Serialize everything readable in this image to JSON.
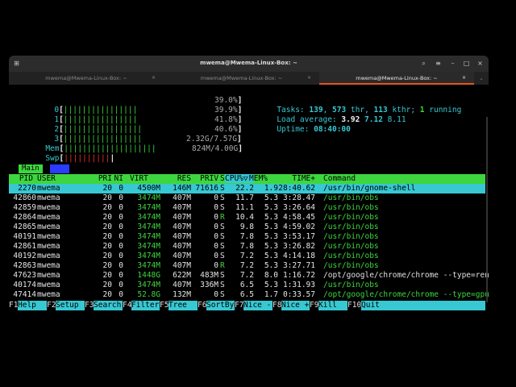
{
  "window": {
    "title": "mwema@Mwema-Linux-Box: ~",
    "tabs": [
      {
        "label": "mwema@Mwema-Linux-Box: ~",
        "active": false
      },
      {
        "label": "mwema@Mwema-Linux-Box: ~",
        "active": false
      },
      {
        "label": "mwema@Mwema-Linux-Box: ~",
        "active": true
      }
    ],
    "tab_close": "×"
  },
  "meters": {
    "cpus": [
      {
        "num": "0",
        "bar": "||||||||||||||||",
        "pct": "39.0%"
      },
      {
        "num": "1",
        "bar": "||||||||||||||||",
        "pct": "39.9%"
      },
      {
        "num": "2",
        "bar": "|||||||||||||||||",
        "pct": "41.8%"
      },
      {
        "num": "3",
        "bar": "|||||||||||||||||",
        "pct": "40.6%"
      }
    ],
    "mem": {
      "label": "Mem",
      "bar": "||||||||||||||||||||",
      "value": "2.32G/7.57G"
    },
    "swp": {
      "label": "Swp",
      "bar": "||||||||||",
      "value": "824M/4.00G"
    }
  },
  "summary": {
    "tasks_label": "Tasks:",
    "tasks": "139",
    "thr": "573",
    "thr_label": "thr,",
    "kthr": "113",
    "kthr_label": "kthr;",
    "running": "1",
    "running_label": "running",
    "load_label": "Load average:",
    "load1": "3.92",
    "load5": "7.12",
    "load15": "8.11",
    "uptime_label": "Uptime:",
    "uptime": "08:40:00"
  },
  "screen_tabs": [
    "Main",
    "I/O"
  ],
  "columns": [
    "PID",
    "USER",
    "PRI",
    "NI",
    "VIRT",
    "RES",
    "PRIV",
    "S",
    "CPU%▽",
    "MEM%",
    "TIME+",
    "Command"
  ],
  "processes": [
    {
      "pid": "2270",
      "user": "mwema",
      "pri": "20",
      "ni": "0",
      "virt": "4500M",
      "res": "146M",
      "priv": "71616",
      "s": "S",
      "cpu": "22.2",
      "mem": "1.9",
      "time": "28:40.62",
      "cmd": "/usr/bin/gnome-shell",
      "selected": true
    },
    {
      "pid": "42860",
      "user": "mwema",
      "pri": "20",
      "ni": "0",
      "virt": "3474M",
      "res": "407M",
      "priv": "0",
      "s": "S",
      "cpu": "11.7",
      "mem": "5.3",
      "time": "3:28.47",
      "cmd": "/usr/bin/obs"
    },
    {
      "pid": "42859",
      "user": "mwema",
      "pri": "20",
      "ni": "0",
      "virt": "3474M",
      "res": "407M",
      "priv": "0",
      "s": "S",
      "cpu": "11.1",
      "mem": "5.3",
      "time": "3:26.64",
      "cmd": "/usr/bin/obs"
    },
    {
      "pid": "42864",
      "user": "mwema",
      "pri": "20",
      "ni": "0",
      "virt": "3474M",
      "res": "407M",
      "priv": "0",
      "s": "R",
      "cpu": "10.4",
      "mem": "5.3",
      "time": "4:58.45",
      "cmd": "/usr/bin/obs"
    },
    {
      "pid": "42865",
      "user": "mwema",
      "pri": "20",
      "ni": "0",
      "virt": "3474M",
      "res": "407M",
      "priv": "0",
      "s": "S",
      "cpu": "9.8",
      "mem": "5.3",
      "time": "4:59.02",
      "cmd": "/usr/bin/obs"
    },
    {
      "pid": "40191",
      "user": "mwema",
      "pri": "20",
      "ni": "0",
      "virt": "3474M",
      "res": "407M",
      "priv": "0",
      "s": "S",
      "cpu": "7.8",
      "mem": "5.3",
      "time": "3:53.17",
      "cmd": "/usr/bin/obs"
    },
    {
      "pid": "42861",
      "user": "mwema",
      "pri": "20",
      "ni": "0",
      "virt": "3474M",
      "res": "407M",
      "priv": "0",
      "s": "S",
      "cpu": "7.8",
      "mem": "5.3",
      "time": "3:26.82",
      "cmd": "/usr/bin/obs"
    },
    {
      "pid": "40192",
      "user": "mwema",
      "pri": "20",
      "ni": "0",
      "virt": "3474M",
      "res": "407M",
      "priv": "0",
      "s": "S",
      "cpu": "7.2",
      "mem": "5.3",
      "time": "4:14.18",
      "cmd": "/usr/bin/obs"
    },
    {
      "pid": "42863",
      "user": "mwema",
      "pri": "20",
      "ni": "0",
      "virt": "3474M",
      "res": "407M",
      "priv": "0",
      "s": "R",
      "cpu": "7.2",
      "mem": "5.3",
      "time": "3:27.71",
      "cmd": "/usr/bin/obs"
    },
    {
      "pid": "47623",
      "user": "mwema",
      "pri": "20",
      "ni": "0",
      "virt": "1448G",
      "res": "622M",
      "priv": "483M",
      "s": "S",
      "cpu": "7.2",
      "mem": "8.0",
      "time": "1:16.72",
      "cmd": "/opt/google/chrome/chrome --type=ren"
    },
    {
      "pid": "40174",
      "user": "mwema",
      "pri": "20",
      "ni": "0",
      "virt": "3474M",
      "res": "407M",
      "priv": "336M",
      "s": "S",
      "cpu": "6.5",
      "mem": "5.3",
      "time": "1:31.93",
      "cmd": "/usr/bin/obs"
    },
    {
      "pid": "47414",
      "user": "mwema",
      "pri": "20",
      "ni": "0",
      "virt": "52.8G",
      "res": "132M",
      "priv": "0",
      "s": "S",
      "cpu": "6.5",
      "mem": "1.7",
      "time": "0:33.57",
      "cmd": "/opt/google/chrome/chrome --type=gpu"
    }
  ],
  "function_keys": [
    {
      "key": "F1",
      "label": "Help"
    },
    {
      "key": "F2",
      "label": "Setup"
    },
    {
      "key": "F3",
      "label": "Search"
    },
    {
      "key": "F4",
      "label": "Filter"
    },
    {
      "key": "F5",
      "label": "Tree"
    },
    {
      "key": "F6",
      "label": "SortBy"
    },
    {
      "key": "F7",
      "label": "Nice -"
    },
    {
      "key": "F8",
      "label": "Nice +"
    },
    {
      "key": "F9",
      "label": "Kill"
    },
    {
      "key": "F10",
      "label": "Quit"
    }
  ],
  "colors": {
    "cyan": "#37c8d2",
    "green": "#3ed63e",
    "header_bg": "#2c2c2c",
    "accent": "#e95420"
  }
}
